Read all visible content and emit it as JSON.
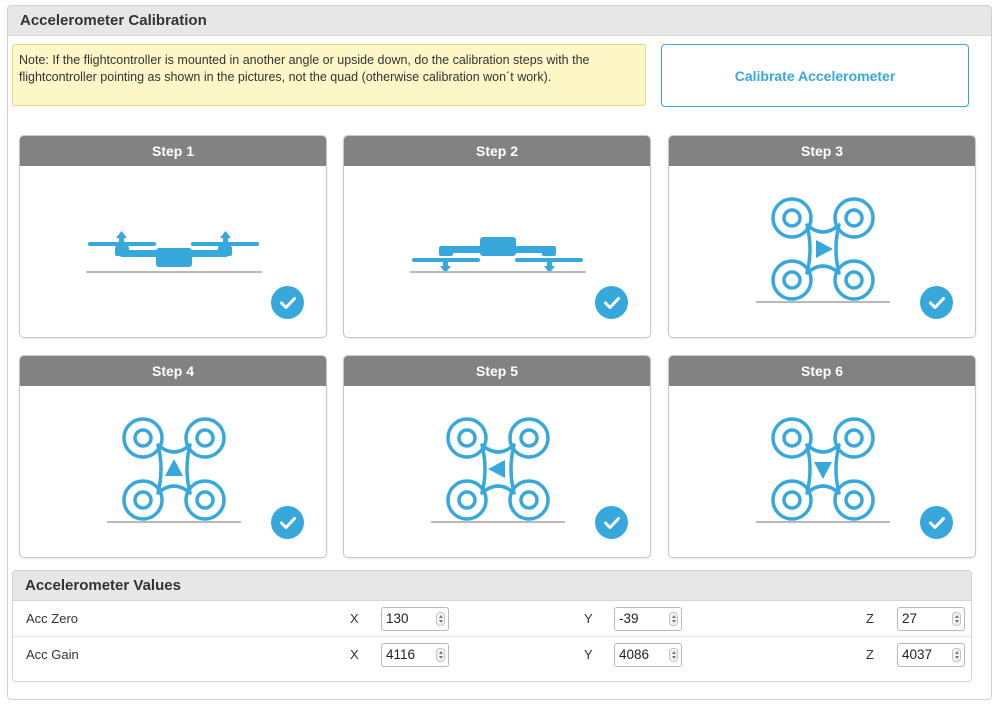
{
  "header": {
    "title": "Accelerometer Calibration"
  },
  "note": {
    "text": "Note: If the flightcontroller is mounted in another angle or upside down, do the calibration steps with the flightcontroller pointing as shown in the pictures, not the quad (otherwise calibration won´t work)."
  },
  "calibrate_button": {
    "label": "Calibrate Accelerometer"
  },
  "colors": {
    "accent": "#37a8db",
    "step_header": "#828282",
    "note_bg": "#fdf7c7"
  },
  "steps": [
    {
      "title": "Step 1",
      "orientation": "level-side",
      "done": true
    },
    {
      "title": "Step 2",
      "orientation": "upside-down-side",
      "done": true
    },
    {
      "title": "Step 3",
      "orientation": "top-arrow-right",
      "done": true
    },
    {
      "title": "Step 4",
      "orientation": "top-arrow-up",
      "done": true
    },
    {
      "title": "Step 5",
      "orientation": "top-arrow-left",
      "done": true
    },
    {
      "title": "Step 6",
      "orientation": "top-arrow-down",
      "done": true
    }
  ],
  "values": {
    "title": "Accelerometer Values",
    "rows": [
      {
        "label": "Acc Zero",
        "x_label": "X",
        "x": "130",
        "y_label": "Y",
        "y": "-39",
        "z_label": "Z",
        "z": "27"
      },
      {
        "label": "Acc Gain",
        "x_label": "X",
        "x": "4116",
        "y_label": "Y",
        "y": "4086",
        "z_label": "Z",
        "z": "4037"
      }
    ]
  }
}
